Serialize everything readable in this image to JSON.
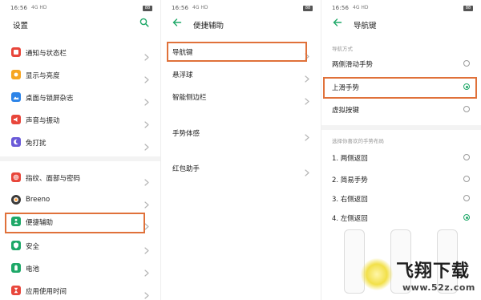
{
  "status": {
    "time": "16:56",
    "signal": "4G HD",
    "battery": "88"
  },
  "settings": {
    "title": "设置",
    "items": [
      {
        "label": "通知与状态栏",
        "icon": "notification-icon",
        "color": "#e8463b"
      },
      {
        "label": "显示与亮度",
        "icon": "brightness-icon",
        "color": "#f6a623"
      },
      {
        "label": "桌面与锁屏杂志",
        "icon": "wallpaper-icon",
        "color": "#2d84e8"
      },
      {
        "label": "声音与振动",
        "icon": "sound-icon",
        "color": "#e8463b"
      },
      {
        "label": "免打扰",
        "icon": "moon-icon",
        "color": "#6a5ad8"
      },
      {
        "label": "指纹、面部与密码",
        "icon": "fingerprint-icon",
        "color": "#e8463b"
      },
      {
        "label": "Breeno",
        "icon": "breeno-icon",
        "color": "#3a3a3a"
      },
      {
        "label": "便捷辅助",
        "icon": "assist-icon",
        "color": "#1ea868"
      },
      {
        "label": "安全",
        "icon": "shield-icon",
        "color": "#1ea868"
      },
      {
        "label": "电池",
        "icon": "battery-icon",
        "color": "#1ea868"
      },
      {
        "label": "应用使用时间",
        "icon": "hourglass-icon",
        "color": "#e8463b"
      }
    ]
  },
  "assist": {
    "title": "便捷辅助",
    "items": [
      {
        "label": "导航键"
      },
      {
        "label": "悬浮球"
      },
      {
        "label": "智能侧边栏"
      },
      {
        "label": "手势体感"
      },
      {
        "label": "红包助手"
      }
    ]
  },
  "nav": {
    "title": "导航键",
    "section1": "导航方式",
    "modes": [
      {
        "label": "两侧滑动手势",
        "selected": false
      },
      {
        "label": "上滑手势",
        "selected": true
      },
      {
        "label": "虚拟按键",
        "selected": false
      }
    ],
    "section2": "选择你喜欢的手势布局",
    "layouts": [
      {
        "label": "1. 两侧返回",
        "selected": false
      },
      {
        "label": "2. 简易手势",
        "selected": false
      },
      {
        "label": "3. 右侧返回",
        "selected": false
      },
      {
        "label": "4. 左侧返回",
        "selected": true
      }
    ]
  },
  "watermark": {
    "title": "飞翔下载",
    "url": "www.52z.com"
  },
  "colors": {
    "accent": "#1ea868",
    "highlight": "#e0713a"
  }
}
